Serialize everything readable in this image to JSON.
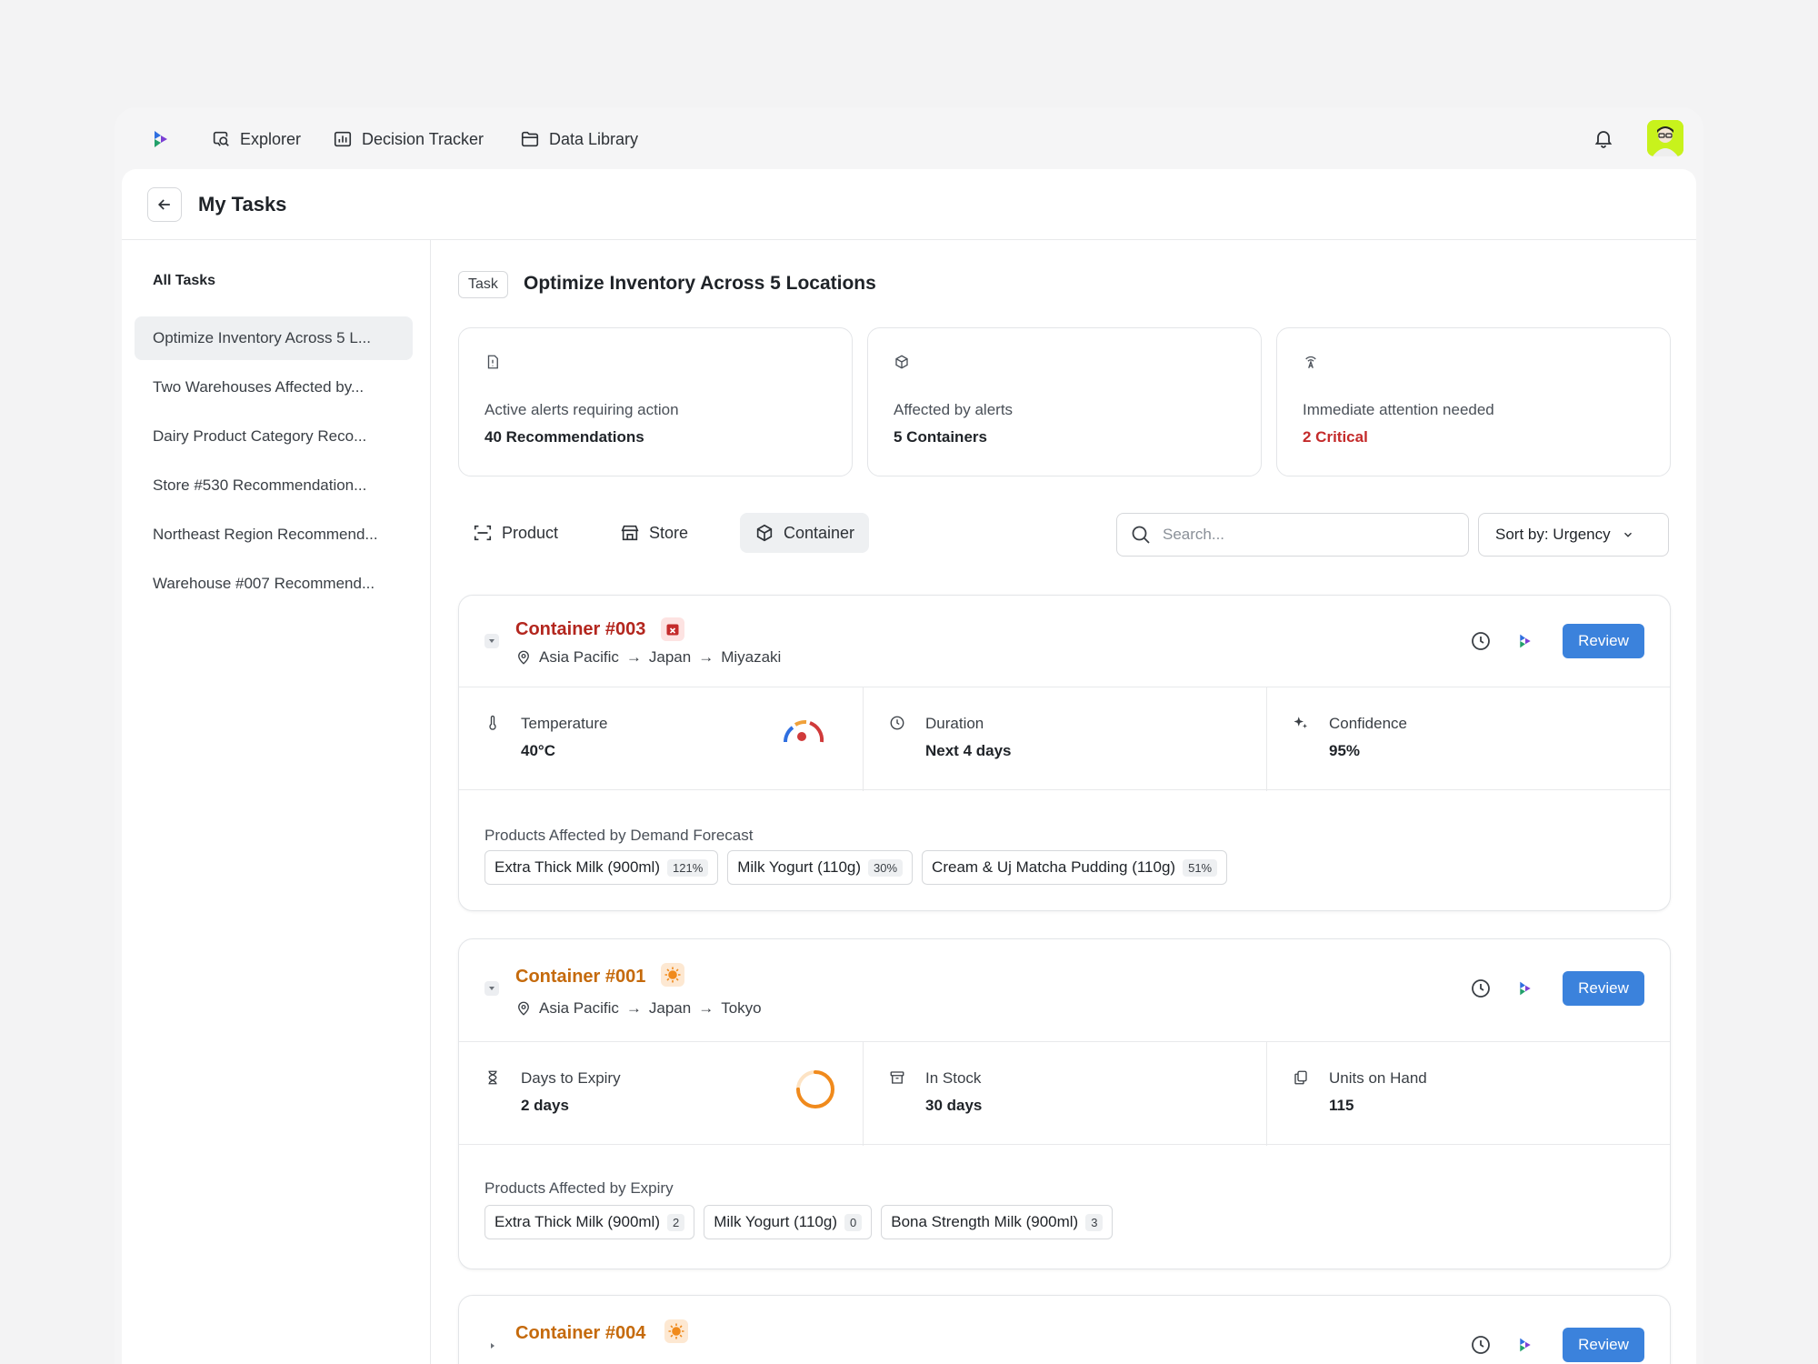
{
  "nav": {
    "items": [
      {
        "label": "Explorer",
        "icon": "search-chat-icon"
      },
      {
        "label": "Decision Tracker",
        "icon": "bar-chart-icon"
      },
      {
        "label": "Data Library",
        "icon": "folder-icon"
      }
    ]
  },
  "page": {
    "title": "My Tasks"
  },
  "sidebar": {
    "heading": "All Tasks",
    "items": [
      {
        "label": "Optimize Inventory Across 5 L...",
        "active": true
      },
      {
        "label": "Two Warehouses Affected by..."
      },
      {
        "label": "Dairy Product Category Reco..."
      },
      {
        "label": "Store #530 Recommendation..."
      },
      {
        "label": "Northeast Region Recommend..."
      },
      {
        "label": "Warehouse #007 Recommend..."
      }
    ]
  },
  "task": {
    "tag": "Task",
    "title": "Optimize Inventory Across 5 Locations"
  },
  "stats": [
    {
      "label": "Active alerts requiring action",
      "value": "40 Recommendations",
      "icon": "alert-doc-icon"
    },
    {
      "label": "Affected by alerts",
      "value": "5 Containers",
      "icon": "box-icon"
    },
    {
      "label": "Immediate attention needed",
      "value": "2 Critical",
      "icon": "signal-tower-icon",
      "color": "#c42b2b"
    }
  ],
  "tabs": [
    {
      "label": "Product",
      "icon": "scan-icon"
    },
    {
      "label": "Store",
      "icon": "store-icon"
    },
    {
      "label": "Container",
      "icon": "container-icon",
      "active": true
    }
  ],
  "search": {
    "placeholder": "Search..."
  },
  "sort": {
    "label": "Sort by: Urgency"
  },
  "colors": {
    "accent": "#3b82dc",
    "critical": "#b3261e",
    "warning": "#c56a0c"
  },
  "cards": [
    {
      "title": "Container #003",
      "status": "critical",
      "location": [
        "Asia Pacific",
        "Japan",
        "Miyazaki"
      ],
      "review": "Review",
      "metrics": [
        {
          "label": "Temperature",
          "value": "40°C",
          "icon": "thermometer-icon",
          "gauge_level": 0.85
        },
        {
          "label": "Duration",
          "value": "Next 4 days",
          "icon": "clock-icon"
        },
        {
          "label": "Confidence",
          "value": "95%",
          "icon": "sparkles-icon"
        }
      ],
      "section": "Products Affected by Demand Forecast",
      "chips": [
        {
          "name": "Extra Thick Milk (900ml)",
          "count": "121%"
        },
        {
          "name": "Milk Yogurt (110g)",
          "count": "30%"
        },
        {
          "name": "Cream & Uj Matcha Pudding (110g)",
          "count": "51%"
        }
      ]
    },
    {
      "title": "Container #001",
      "status": "warning",
      "location": [
        "Asia Pacific",
        "Japan",
        "Tokyo"
      ],
      "review": "Review",
      "metrics": [
        {
          "label": "Days to Expiry",
          "value": "2 days",
          "icon": "hourglass-icon",
          "ring_level": 0.75
        },
        {
          "label": "In Stock",
          "value": "30 days",
          "icon": "archive-icon"
        },
        {
          "label": "Units on Hand",
          "value": "115",
          "icon": "copy-icon"
        }
      ],
      "section": "Products Affected by Expiry",
      "chips": [
        {
          "name": "Extra Thick Milk (900ml)",
          "count": "2"
        },
        {
          "name": "Milk Yogurt (110g)",
          "count": "0"
        },
        {
          "name": "Bona Strength Milk (900ml)",
          "count": "3"
        }
      ]
    },
    {
      "title": "Container #004",
      "status": "warning",
      "review": "Review"
    }
  ]
}
